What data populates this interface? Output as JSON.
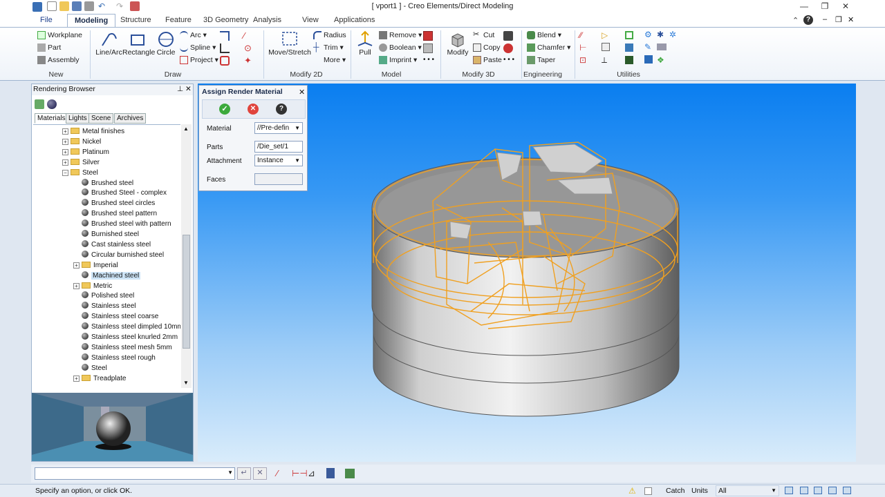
{
  "window": {
    "title": "[ vport1 ] - Creo Elements/Direct Modeling"
  },
  "tabs": [
    "File",
    "Modeling",
    "Structure",
    "Feature",
    "3D Geometry",
    "Analysis",
    "View",
    "Applications"
  ],
  "ribbon": {
    "new": {
      "workplane": "Workplane",
      "part": "Part",
      "assembly": "Assembly",
      "group": "New"
    },
    "draw": {
      "linearc": "Line/Arc",
      "rectangle": "Rectangle",
      "circle": "Circle",
      "arc": "Arc",
      "spline": "Spline",
      "project": "Project",
      "group": "Draw"
    },
    "modify2d": {
      "movestretch": "Move/Stretch",
      "radius": "Radius",
      "trim": "Trim",
      "more": "More",
      "group": "Modify 2D"
    },
    "model": {
      "pull": "Pull",
      "remove": "Remove",
      "boolean": "Boolean",
      "imprint": "Imprint",
      "group": "Model"
    },
    "modify3d": {
      "modify": "Modify",
      "cut": "Cut",
      "copy": "Copy",
      "paste": "Paste",
      "group": "Modify 3D"
    },
    "engineering": {
      "blend": "Blend",
      "chamfer": "Chamfer",
      "taper": "Taper",
      "group": "Engineering"
    },
    "utilities": {
      "group": "Utilities"
    }
  },
  "browser": {
    "title": "Rendering Browser",
    "tabs": [
      "Materials",
      "Lights",
      "Scene",
      "Archives"
    ],
    "tree": [
      {
        "label": "Metal finishes",
        "type": "folder",
        "level": 1
      },
      {
        "label": "Nickel",
        "type": "folder",
        "level": 1
      },
      {
        "label": "Platinum",
        "type": "folder",
        "level": 1
      },
      {
        "label": "Silver",
        "type": "folder",
        "level": 1
      },
      {
        "label": "Steel",
        "type": "folder-open",
        "level": 1
      },
      {
        "label": "Brushed steel",
        "type": "material",
        "level": 2
      },
      {
        "label": "Brushed Steel - complex",
        "type": "material",
        "level": 2
      },
      {
        "label": "Brushed steel circles",
        "type": "material",
        "level": 2
      },
      {
        "label": "Brushed steel pattern",
        "type": "material",
        "level": 2
      },
      {
        "label": "Brushed steel with pattern",
        "type": "material",
        "level": 2
      },
      {
        "label": "Burnished steel",
        "type": "material",
        "level": 2
      },
      {
        "label": "Cast stainless steel",
        "type": "material",
        "level": 2
      },
      {
        "label": "Circular burnished steel",
        "type": "material",
        "level": 2
      },
      {
        "label": "Imperial",
        "type": "folder",
        "level": 2
      },
      {
        "label": "Machined steel",
        "type": "material",
        "level": 2,
        "selected": true
      },
      {
        "label": "Metric",
        "type": "folder",
        "level": 2
      },
      {
        "label": "Polished steel",
        "type": "material",
        "level": 2
      },
      {
        "label": "Stainless steel",
        "type": "material",
        "level": 2
      },
      {
        "label": "Stainless steel coarse",
        "type": "material",
        "level": 2
      },
      {
        "label": "Stainless steel dimpled 10mm",
        "type": "material",
        "level": 2
      },
      {
        "label": "Stainless steel knurled 2mm",
        "type": "material",
        "level": 2
      },
      {
        "label": "Stainless steel mesh 5mm",
        "type": "material",
        "level": 2
      },
      {
        "label": "Stainless steel rough",
        "type": "material",
        "level": 2
      },
      {
        "label": "Steel",
        "type": "material",
        "level": 2
      },
      {
        "label": "Treadplate",
        "type": "folder",
        "level": 2
      }
    ]
  },
  "dialog": {
    "title": "Assign Render Material",
    "material_label": "Material",
    "material_value": "//Pre-defin",
    "parts_label": "Parts",
    "parts_value": "/Die_set/1",
    "attachment_label": "Attachment",
    "attachment_value": "Instance",
    "faces_label": "Faces"
  },
  "status": {
    "message": "Specify an option, or click OK.",
    "catch": "Catch",
    "units": "Units",
    "units_value": "All"
  },
  "colors": {
    "accent": "#1c3f8c",
    "wire": "#f0a020",
    "viewport_top": "#0a7ef0"
  }
}
